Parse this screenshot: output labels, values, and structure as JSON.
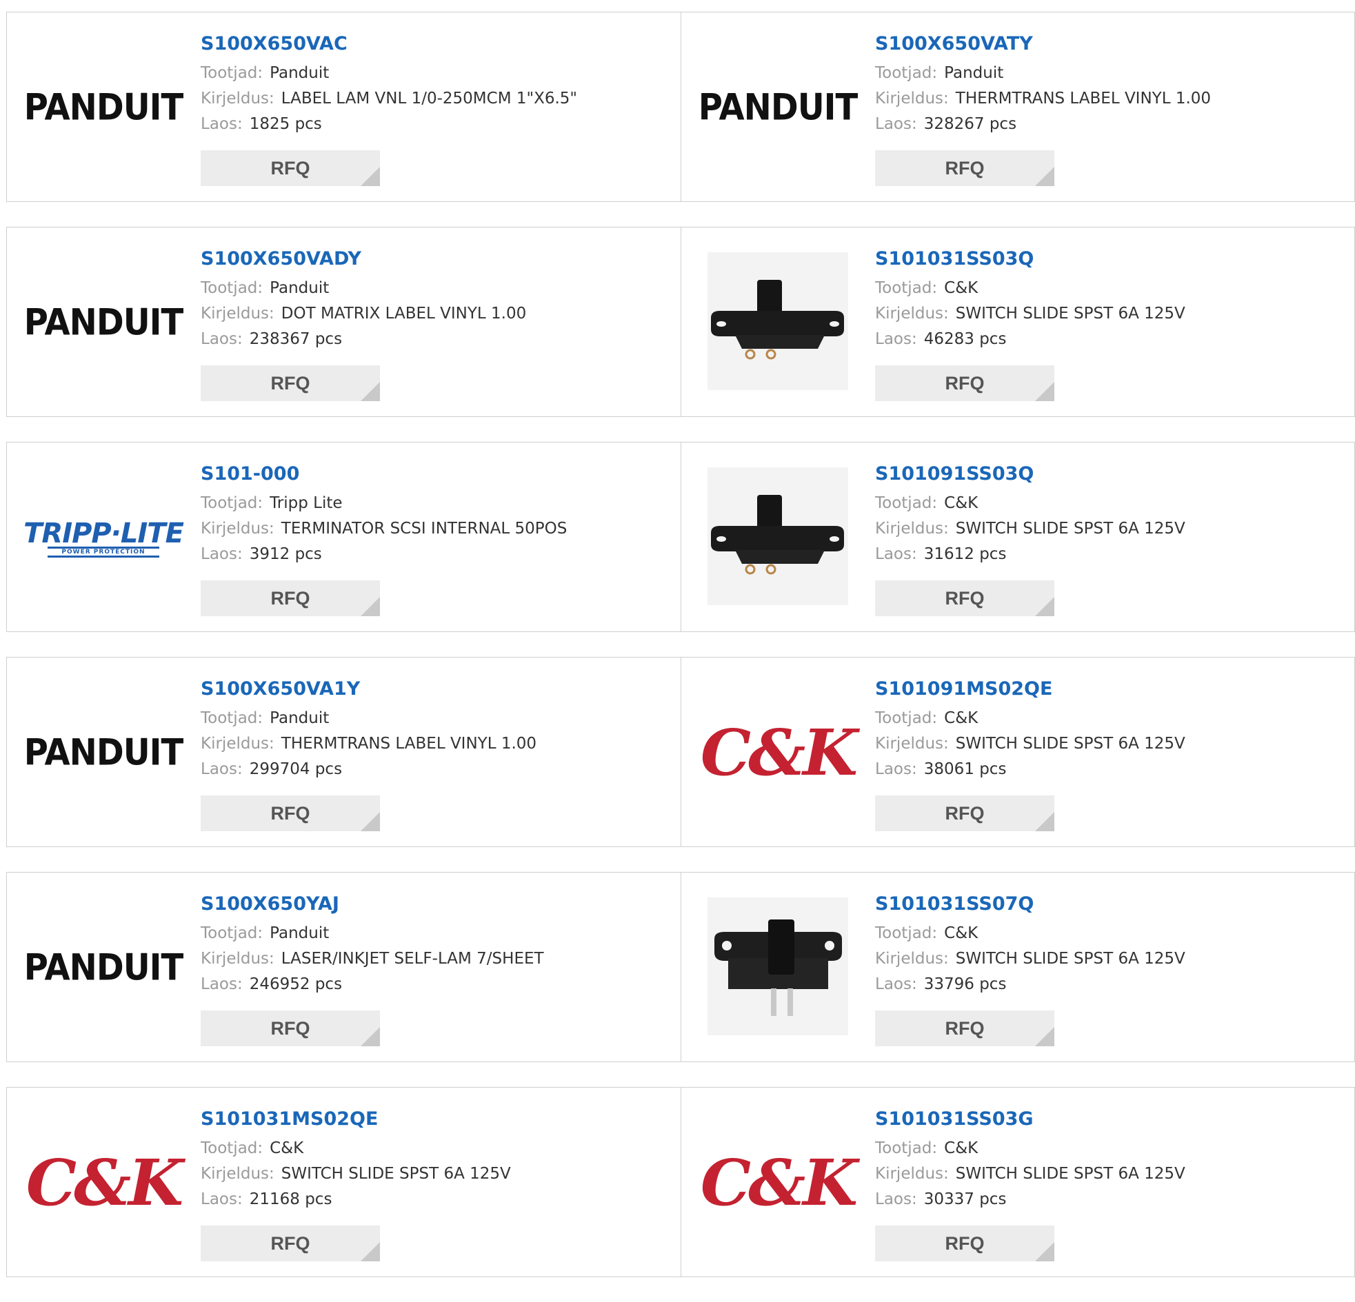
{
  "labels": {
    "manufacturer": "Tootjad:",
    "description": "Kirjeldus:",
    "stock": "Laos:"
  },
  "colors": {
    "part_number": "#1a67b8",
    "label": "#9a9a9a",
    "rfq_bg": "#ececec"
  },
  "products": [
    {
      "part": "S100X650VAC",
      "manufacturer": "Panduit",
      "description": "LABEL LAM VNL 1/0-250MCM 1\"X6.5\"",
      "stock": "1825 pcs",
      "rfq": "RFQ",
      "logo": "panduit",
      "logo_text": "PANDUIT"
    },
    {
      "part": "S100X650VATY",
      "manufacturer": "Panduit",
      "description": "THERMTRANS LABEL VINYL 1.00",
      "stock": "328267 pcs",
      "rfq": "RFQ",
      "logo": "panduit",
      "logo_text": "PANDUIT"
    },
    {
      "part": "S100X650VADY",
      "manufacturer": "Panduit",
      "description": "DOT MATRIX LABEL VINYL 1.00",
      "stock": "238367 pcs",
      "rfq": "RFQ",
      "logo": "panduit",
      "logo_text": "PANDUIT"
    },
    {
      "part": "S101031SS03Q",
      "manufacturer": "C&K",
      "description": "SWITCH SLIDE SPST 6A 125V",
      "stock": "46283 pcs",
      "rfq": "RFQ",
      "logo": "switch-photo"
    },
    {
      "part": "S101-000",
      "manufacturer": "Tripp Lite",
      "description": "TERMINATOR SCSI INTERNAL 50POS",
      "stock": "3912 pcs",
      "rfq": "RFQ",
      "logo": "tripplite",
      "logo_text": "TRIPP·LITE",
      "logo_sub": "POWER PROTECTION"
    },
    {
      "part": "S101091SS03Q",
      "manufacturer": "C&K",
      "description": "SWITCH SLIDE SPST 6A 125V",
      "stock": "31612 pcs",
      "rfq": "RFQ",
      "logo": "switch-photo"
    },
    {
      "part": "S100X650VA1Y",
      "manufacturer": "Panduit",
      "description": "THERMTRANS LABEL VINYL 1.00",
      "stock": "299704 pcs",
      "rfq": "RFQ",
      "logo": "panduit",
      "logo_text": "PANDUIT"
    },
    {
      "part": "S101091MS02QE",
      "manufacturer": "C&K",
      "description": "SWITCH SLIDE SPST 6A 125V",
      "stock": "38061 pcs",
      "rfq": "RFQ",
      "logo": "ck",
      "logo_text": "C&K"
    },
    {
      "part": "S100X650YAJ",
      "manufacturer": "Panduit",
      "description": "LASER/INKJET SELF-LAM 7/SHEET",
      "stock": "246952 pcs",
      "rfq": "RFQ",
      "logo": "panduit",
      "logo_text": "PANDUIT"
    },
    {
      "part": "S101031SS07Q",
      "manufacturer": "C&K",
      "description": "SWITCH SLIDE SPST 6A 125V",
      "stock": "33796 pcs",
      "rfq": "RFQ",
      "logo": "switch-photo-2"
    },
    {
      "part": "S101031MS02QE",
      "manufacturer": "C&K",
      "description": "SWITCH SLIDE SPST 6A 125V",
      "stock": "21168 pcs",
      "rfq": "RFQ",
      "logo": "ck",
      "logo_text": "C&K"
    },
    {
      "part": "S101031SS03G",
      "manufacturer": "C&K",
      "description": "SWITCH SLIDE SPST 6A 125V",
      "stock": "30337 pcs",
      "rfq": "RFQ",
      "logo": "ck",
      "logo_text": "C&K"
    }
  ]
}
